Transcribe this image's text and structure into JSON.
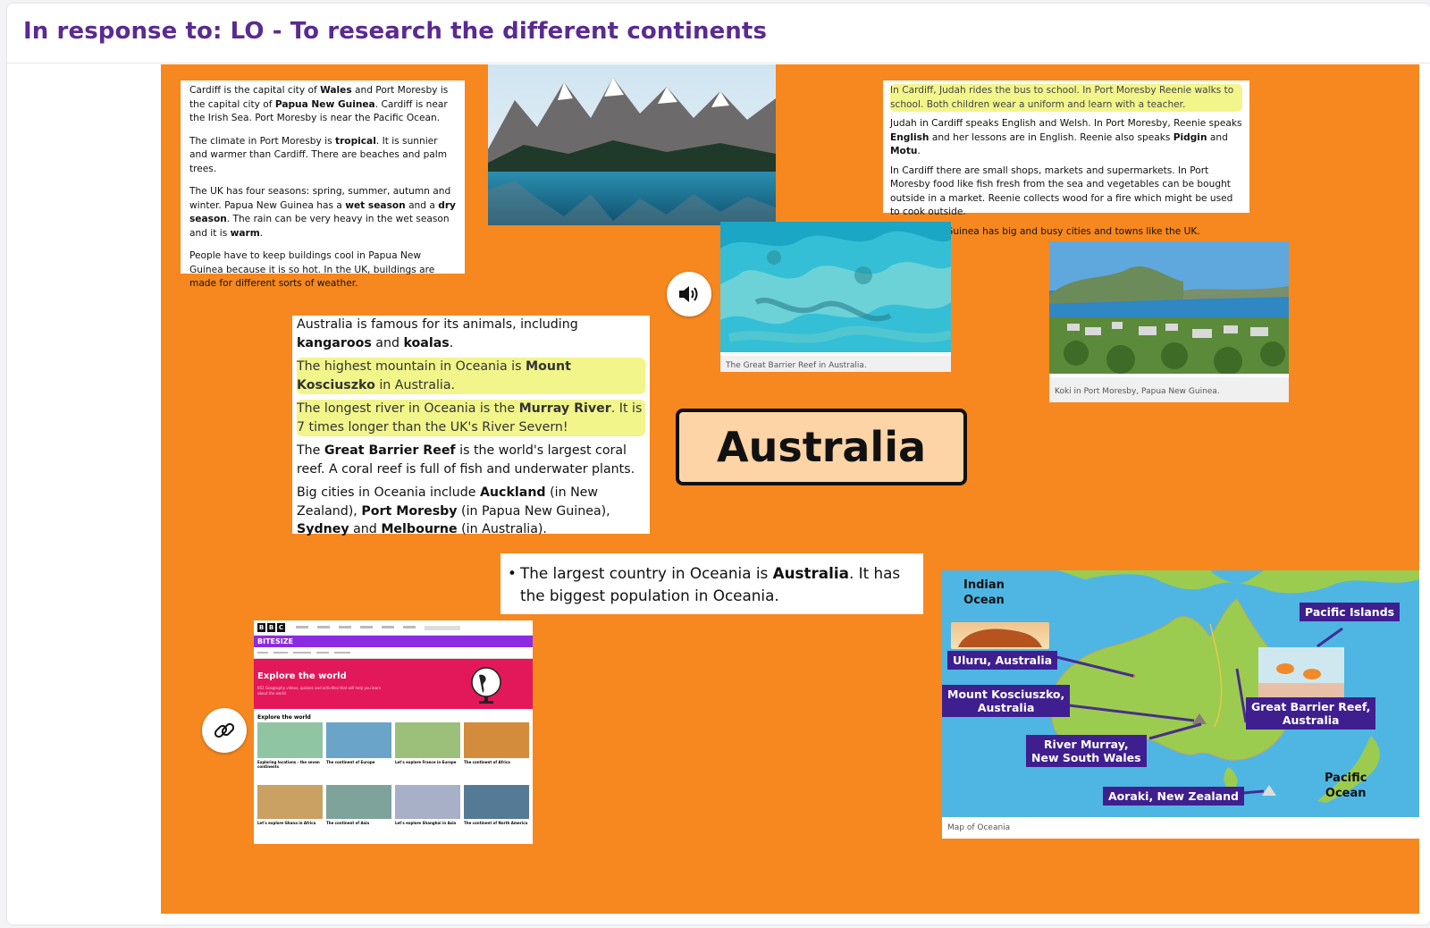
{
  "header": {
    "title": "In response to: LO - To research the different continents"
  },
  "board": {
    "colors": {
      "background": "#f6881f",
      "highlight": "#f2f58a",
      "title": "#5b2a91",
      "map_tag": "#3f1f8f"
    },
    "text_box_cardiff": {
      "p1": {
        "a": "Cardiff is the capital city of ",
        "b": "Wales",
        "c": " and Port Moresby is the capital city of ",
        "d": "Papua New Guinea",
        "e": ". Cardiff is near the Irish Sea. Port Moresby is near the Pacific Ocean."
      },
      "p2": {
        "a": "The climate in Port Moresby is ",
        "b": "tropical",
        "c": ". It is sunnier and warmer than Cardiff. There are beaches and palm trees."
      },
      "p3": {
        "a": "The UK has four seasons: spring, summer, autumn and winter. Papua New Guinea has a ",
        "b": "wet season",
        "c": " and a ",
        "d": "dry season",
        "e": ". The rain can be very heavy in the wet season and it is ",
        "f": "warm",
        "g": "."
      },
      "p4": "People have to keep buildings cool in Papua New Guinea because it is so hot. In the UK, buildings are made for different sorts of weather."
    },
    "text_box_judah": {
      "p1": "In Cardiff, Judah rides the bus to school. In Port Moresby Reenie walks to school. Both children wear a uniform and learn with a teacher.",
      "p2": {
        "a": "Judah in Cardiff speaks English and Welsh. In Port Moresby, Reenie speaks ",
        "b": "English",
        "c": " and her lessons are in English. Reenie also speaks ",
        "d": "Pidgin",
        "e": " and ",
        "f": "Motu",
        "g": "."
      },
      "p3": "In Cardiff there are small shops, markets and supermarkets. In Port Moresby food like fish fresh from the sea and vegetables can be bought outside in a market. Reenie collects wood for a fire which might be used to cook outside.",
      "p4": "Papua New Guinea has big and busy cities and towns like the UK."
    },
    "text_box_oceania": {
      "p1": {
        "a": "Australia is famous for its animals, including ",
        "b": "kangaroos",
        "c": " and ",
        "d": "koalas",
        "e": "."
      },
      "p2": {
        "a": "The highest mountain in Oceania is ",
        "b": "Mount Kosciuszko",
        "c": " in Australia."
      },
      "p3": {
        "a": "The longest river in Oceania is the ",
        "b": "Murray River",
        "c": ". It is 7 times longer than the UK's River Severn!"
      },
      "p4": {
        "a": "The ",
        "b": "Great Barrier Reef",
        "c": " is the world's largest coral reef. A coral reef is full of fish and underwater plants."
      },
      "p5": {
        "a": "Big cities in Oceania include ",
        "b": "Auckland",
        "c": " (in New Zealand), ",
        "d": "Port Moresby",
        "e": " (in Papua New Guinea), ",
        "f": "Sydney",
        "g": " and ",
        "h": "Melbourne",
        "i": " (in Australia)."
      }
    },
    "text_box_largest": {
      "bullet": "•",
      "a": "The largest country in Oceania is ",
      "b": "Australia",
      "c": ". It has the biggest population in Oceania."
    },
    "label_australia": "Australia",
    "captions": {
      "reef": "The Great Barrier Reef in Australia.",
      "koki": "Koki in Port Moresby, Papua New Guinea.",
      "map": "Map of Oceania"
    },
    "map": {
      "oceans": {
        "indian": "Indian\nOcean",
        "pacific": "Pacific\nOcean"
      },
      "tags": {
        "pacific_islands": "Pacific Islands",
        "uluru": "Uluru, Australia",
        "kosciuszko": "Mount Kosciuszko,\nAustralia",
        "reef": "Great Barrier Reef,\nAustralia",
        "murray": "River Murray,\nNew South Wales",
        "aoraki": "Aoraki, New Zealand"
      }
    },
    "bbc": {
      "logo_letters": [
        "B",
        "B",
        "C"
      ],
      "brand": "BITESIZE",
      "hero_title": "Explore the world",
      "hero_sub": "KS1 Geography videos, quizzes and activities that will help you learn about the world",
      "section": "Explore the world",
      "cards": [
        "Exploring locations - the seven continents",
        "The continent of Europe",
        "Let's explore France in Europe",
        "The continent of Africa"
      ],
      "cards_row2": [
        "Let's explore Ghana in Africa",
        "The continent of Asia",
        "Let's explore Shanghai in Asia",
        "The continent of North America"
      ]
    },
    "icons": {
      "audio": "speaker-icon",
      "link": "link-icon"
    }
  }
}
